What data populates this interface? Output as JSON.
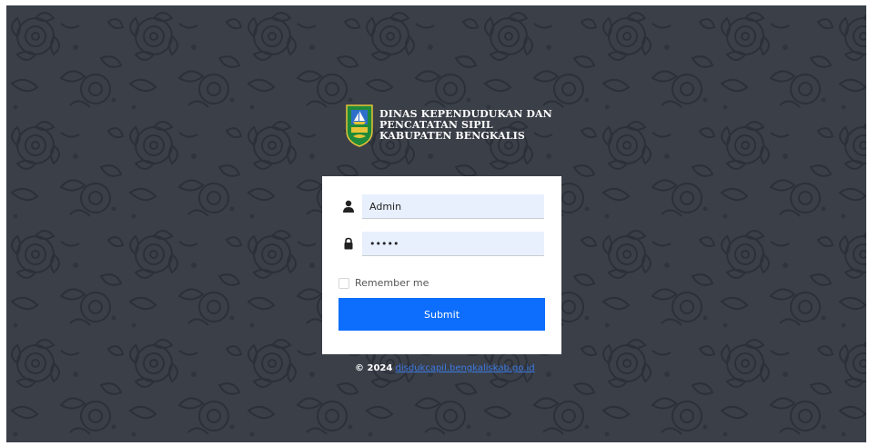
{
  "colors": {
    "background": "#3a3f48",
    "card": "#ffffff",
    "input_fill": "#e8f0fe",
    "submit": "#0d6efd",
    "link": "#3d7be3"
  },
  "header": {
    "logo_icon": "bengkalis-emblem-icon",
    "title_lines": [
      "DINAS KEPENDUDUKAN DAN",
      "PENCATATAN SIPIL",
      "KABUPATEN BENGKALIS"
    ]
  },
  "form": {
    "username": {
      "icon": "user-icon",
      "value": "Admin"
    },
    "password": {
      "icon": "lock-icon",
      "value": "•••••"
    },
    "remember": {
      "label": "Remember me",
      "checked": false
    },
    "submit_label": "Submit"
  },
  "footer": {
    "copyright": "© 2024",
    "link_text": "disdukcapil.bengkaliskab.go.id"
  }
}
